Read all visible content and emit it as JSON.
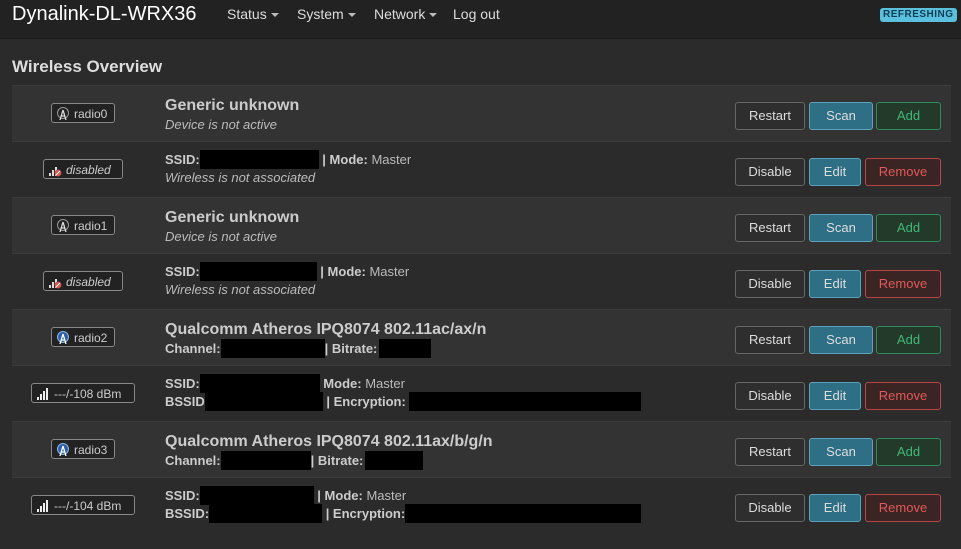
{
  "brand": "Dynalink-DL-WRX36",
  "nav": [
    "Status",
    "System",
    "Network",
    "Log out"
  ],
  "status_badge": "REFRESHING",
  "page_title": "Wireless Overview",
  "colors": {
    "scan": "#2f6f86",
    "add": "#3fb873",
    "remove": "#e05a5a",
    "badge": "#5bc0de"
  },
  "buttons": {
    "restart": "Restart",
    "scan": "Scan",
    "add": "Add",
    "disable": "Disable",
    "edit": "Edit",
    "remove": "Remove"
  },
  "rows": [
    {
      "badge": "radio0",
      "title": "Generic unknown",
      "sub": "Device is not active"
    },
    {
      "badge": "disabled",
      "ssid_label": "SSID:",
      "mode_label": "| Mode:",
      "mode": "Master",
      "sub": "Wireless is not associated"
    },
    {
      "badge": "radio1",
      "title": "Generic unknown",
      "sub": "Device is not active"
    },
    {
      "badge": "disabled",
      "ssid_label": "SSID:",
      "mode_label": "| Mode:",
      "mode": "Master",
      "sub": "Wireless is not associated"
    },
    {
      "badge": "radio2",
      "title": "Qualcomm Atheros IPQ8074 802.11ac/ax/n",
      "channel_label": "Channel:",
      "bitrate_label": "| Bitrate:"
    },
    {
      "badge": "---/-108 dBm",
      "ssid_label": "SSID:",
      "mode_label": "Mode:",
      "mode": "Master",
      "bssid_label": "BSSID",
      "enc_label": "| Encryption:"
    },
    {
      "badge": "radio3",
      "title": "Qualcomm Atheros IPQ8074 802.11ax/b/g/n",
      "channel_label": "Channel:",
      "bitrate_label": "| Bitrate:"
    },
    {
      "badge": "---/-104 dBm",
      "ssid_label": "SSID:",
      "mode_label": "| Mode:",
      "mode": "Master",
      "bssid_label": "BSSID:",
      "enc_label": "| Encryption:"
    }
  ]
}
